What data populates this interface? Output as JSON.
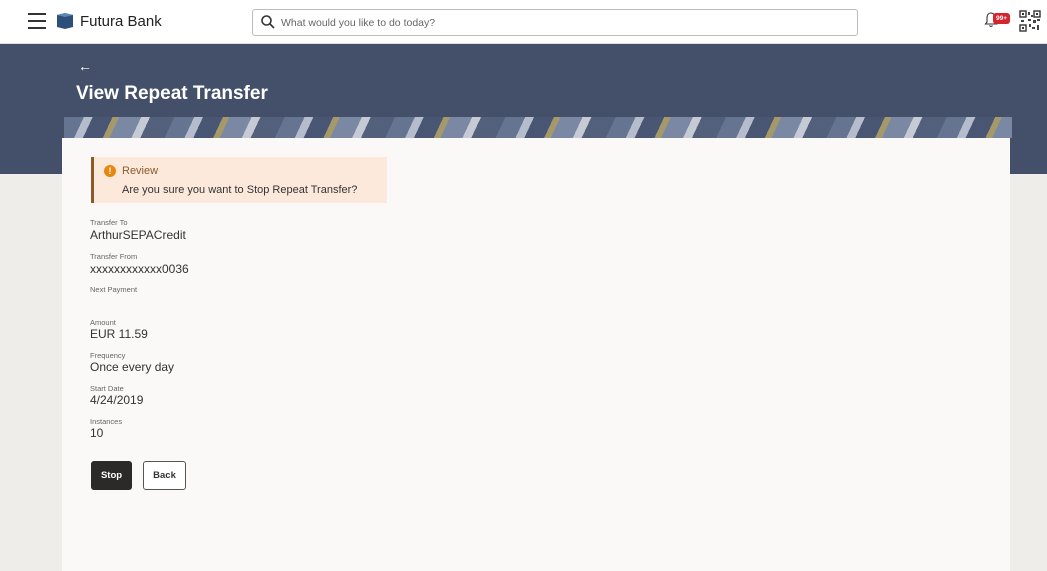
{
  "header": {
    "brand": "Futura Bank",
    "search_placeholder": "What would you like to do today?",
    "notification_badge": "99+"
  },
  "page": {
    "back_arrow": "←",
    "title": "View Repeat Transfer"
  },
  "review": {
    "title": "Review",
    "message": "Are you sure you want to Stop Repeat Transfer?"
  },
  "fields": {
    "transfer_to": {
      "label": "Transfer To",
      "value": "ArthurSEPACredit"
    },
    "transfer_from": {
      "label": "Transfer From",
      "value": "xxxxxxxxxxxx0036"
    },
    "next_payment": {
      "label": "Next Payment",
      "value": ""
    },
    "amount": {
      "label": "Amount",
      "value": "EUR 11.59"
    },
    "frequency": {
      "label": "Frequency",
      "value": "Once every day"
    },
    "start_date": {
      "label": "Start Date",
      "value": "4/24/2019"
    },
    "instances": {
      "label": "Instances",
      "value": "10"
    }
  },
  "actions": {
    "stop_label": "Stop",
    "back_label": "Back"
  },
  "colors": {
    "header_band": "#44506a",
    "primary_button": "#2b2a28",
    "review_bg": "#fde9dc",
    "alert_icon": "#e8870d",
    "badge": "#d5242e"
  },
  "icons": [
    "menu-icon",
    "bank-logo-icon",
    "search-icon",
    "bell-icon",
    "qr-code-icon",
    "back-arrow-icon",
    "info-icon"
  ]
}
